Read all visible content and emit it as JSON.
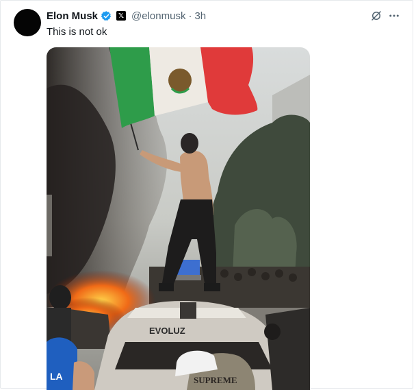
{
  "post": {
    "author_name": "Elon Musk",
    "author_handle": "@elonmusk",
    "separator": "·",
    "time": "3h",
    "text": "This is not ok"
  },
  "icons": {
    "verified": "verified-badge-icon",
    "affiliate": "x-logo-icon",
    "grok": "grok-icon",
    "more": "more-dots-icon"
  },
  "media": {
    "car_sticker_text": "EVOLUZ",
    "cap_text": "SUPREME",
    "hat_logo": "LA"
  },
  "colors": {
    "verified_blue": "#1d9bf0",
    "muted_text": "#536471",
    "flag_green": "#2e9c4a",
    "flag_red": "#e03a3a"
  }
}
